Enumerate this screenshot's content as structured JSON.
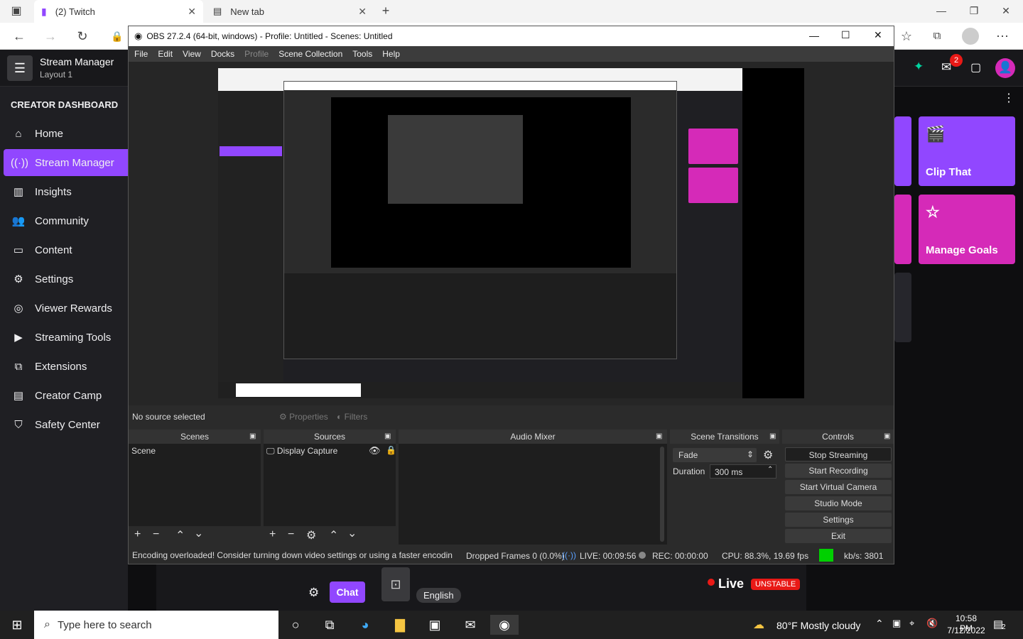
{
  "browser": {
    "tabs": [
      {
        "label": "(2) Twitch",
        "icon": "twitch-icon"
      },
      {
        "label": "New tab",
        "icon": "newtab-icon"
      }
    ],
    "new_tab": "+",
    "win_min": "—",
    "win_max": "❐",
    "win_close": "✕"
  },
  "twitch": {
    "manager_title": "Stream Manager",
    "layout": "Layout 1",
    "dashboard_heading": "CREATOR DASHBOARD",
    "nav": [
      {
        "label": "Home"
      },
      {
        "label": "Stream Manager"
      },
      {
        "label": "Insights"
      },
      {
        "label": "Community"
      },
      {
        "label": "Content"
      },
      {
        "label": "Settings"
      },
      {
        "label": "Viewer Rewards"
      },
      {
        "label": "Streaming Tools"
      },
      {
        "label": "Extensions"
      },
      {
        "label": "Creator Camp"
      },
      {
        "label": "Safety Center"
      }
    ],
    "notif_count": "2",
    "tiles": {
      "clip": "Clip That",
      "goals": "Manage Goals"
    },
    "chat_button": "Chat",
    "language": "English",
    "live_label": "Live",
    "unstable_badge": "UNSTABLE",
    "accent": "#9147ff",
    "tile_color": "#d52ab8"
  },
  "obs": {
    "title": "OBS 27.2.4 (64-bit, windows) - Profile: Untitled - Scenes: Untitled",
    "menu": [
      "File",
      "Edit",
      "View",
      "Docks",
      "Profile",
      "Scene Collection",
      "Tools",
      "Help"
    ],
    "no_source": "No source selected",
    "properties": "Properties",
    "filters": "Filters",
    "docks": {
      "scenes": "Scenes",
      "sources": "Sources",
      "mixer": "Audio Mixer",
      "transitions": "Scene Transitions",
      "controls": "Controls"
    },
    "scene_item": "Scene",
    "source_item": "Display Capture",
    "transition": "Fade",
    "duration_label": "Duration",
    "duration_value": "300 ms",
    "controls": [
      "Stop Streaming",
      "Start Recording",
      "Start Virtual Camera",
      "Studio Mode",
      "Settings",
      "Exit"
    ],
    "status": {
      "warning": "Encoding overloaded! Consider turning down video settings or using a faster encodin",
      "dropped": "Dropped Frames 0 (0.0%)",
      "live": "LIVE: 00:09:56",
      "rec": "REC: 00:00:00",
      "cpu": "CPU: 88.3%, 19.69 fps",
      "kbs": "kb/s: 3801"
    }
  },
  "taskbar": {
    "search_placeholder": "Type here to search",
    "weather": "80°F  Mostly cloudy",
    "time": "10:58 PM",
    "date": "7/12/2022",
    "notif_count": "2"
  }
}
